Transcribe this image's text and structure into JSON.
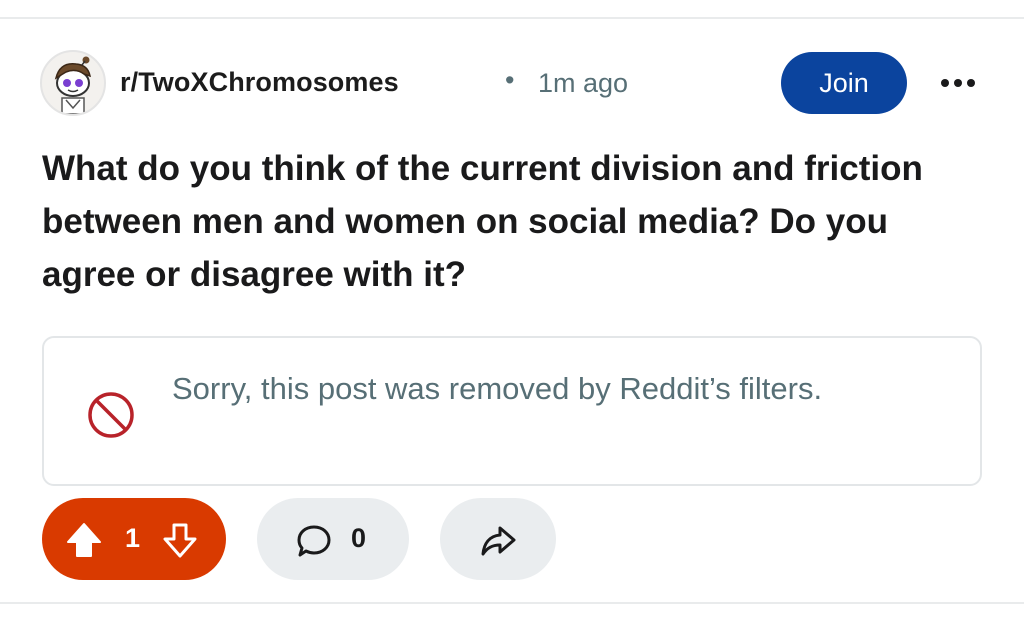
{
  "post": {
    "community": "r/TwoXChromosomes",
    "separator": "•",
    "time": "1m ago",
    "join_label": "Join",
    "title": "What do you think of the current division and friction between men and women on social media? Do you agree or disagree with it?",
    "removed_notice": "Sorry, this post was removed by Reddit’s filters.",
    "vote_count": "1",
    "comment_count": "0"
  },
  "icons": {
    "avatar": "community-avatar",
    "more": "more-options-icon",
    "removed": "prohibited-icon",
    "upvote": "upvote-arrow-icon",
    "downvote": "downvote-arrow-icon",
    "comment": "comment-bubble-icon",
    "share": "share-arrow-icon"
  },
  "colors": {
    "join": "#0b449e",
    "vote_active": "#d93a00",
    "removed_icon": "#b8232a",
    "meta_text": "#576f76",
    "pill_bg": "#eaedef"
  }
}
